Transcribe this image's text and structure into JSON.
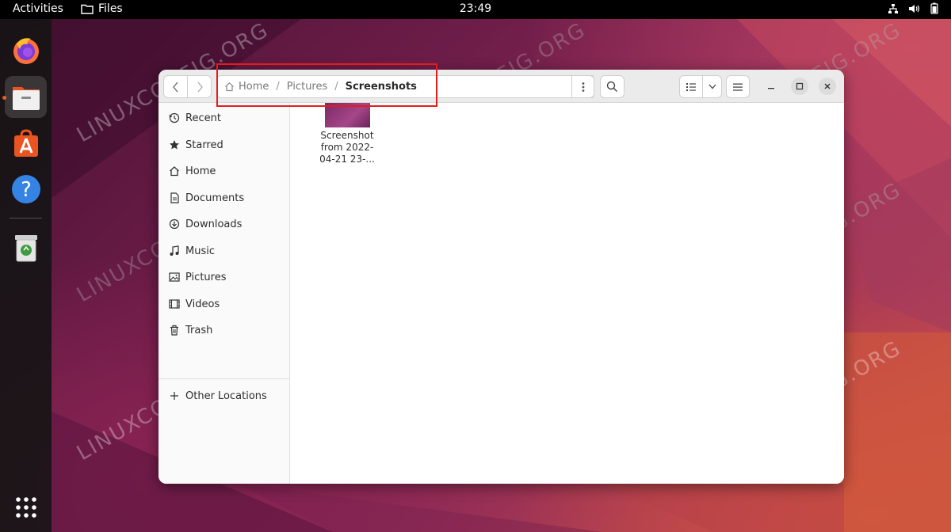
{
  "topbar": {
    "activities": "Activities",
    "app_name": "Files",
    "clock": "23:49"
  },
  "dock": {
    "items": [
      "firefox-icon",
      "files-icon",
      "software-icon",
      "help-icon",
      "trash-icon",
      "app-grid-icon"
    ]
  },
  "watermark": "LINUXCONFIG.ORG",
  "window": {
    "pathbar": {
      "crumbs": [
        "Home",
        "Pictures",
        "Screenshots"
      ]
    },
    "sidebar": {
      "items": [
        {
          "label": "Recent",
          "icon": "clock-icon"
        },
        {
          "label": "Starred",
          "icon": "star-icon"
        },
        {
          "label": "Home",
          "icon": "home-icon"
        },
        {
          "label": "Documents",
          "icon": "document-icon"
        },
        {
          "label": "Downloads",
          "icon": "download-icon"
        },
        {
          "label": "Music",
          "icon": "music-icon"
        },
        {
          "label": "Pictures",
          "icon": "picture-icon"
        },
        {
          "label": "Videos",
          "icon": "video-icon"
        },
        {
          "label": "Trash",
          "icon": "trash-icon"
        }
      ],
      "other_locations": "Other Locations"
    },
    "files": [
      {
        "name_line1": "Screenshot",
        "name_line2": "from 2022-",
        "name_line3": "04-21 23-..."
      }
    ]
  },
  "colors": {
    "accent": "#e95420",
    "highlight_box": "#e01e1e"
  }
}
